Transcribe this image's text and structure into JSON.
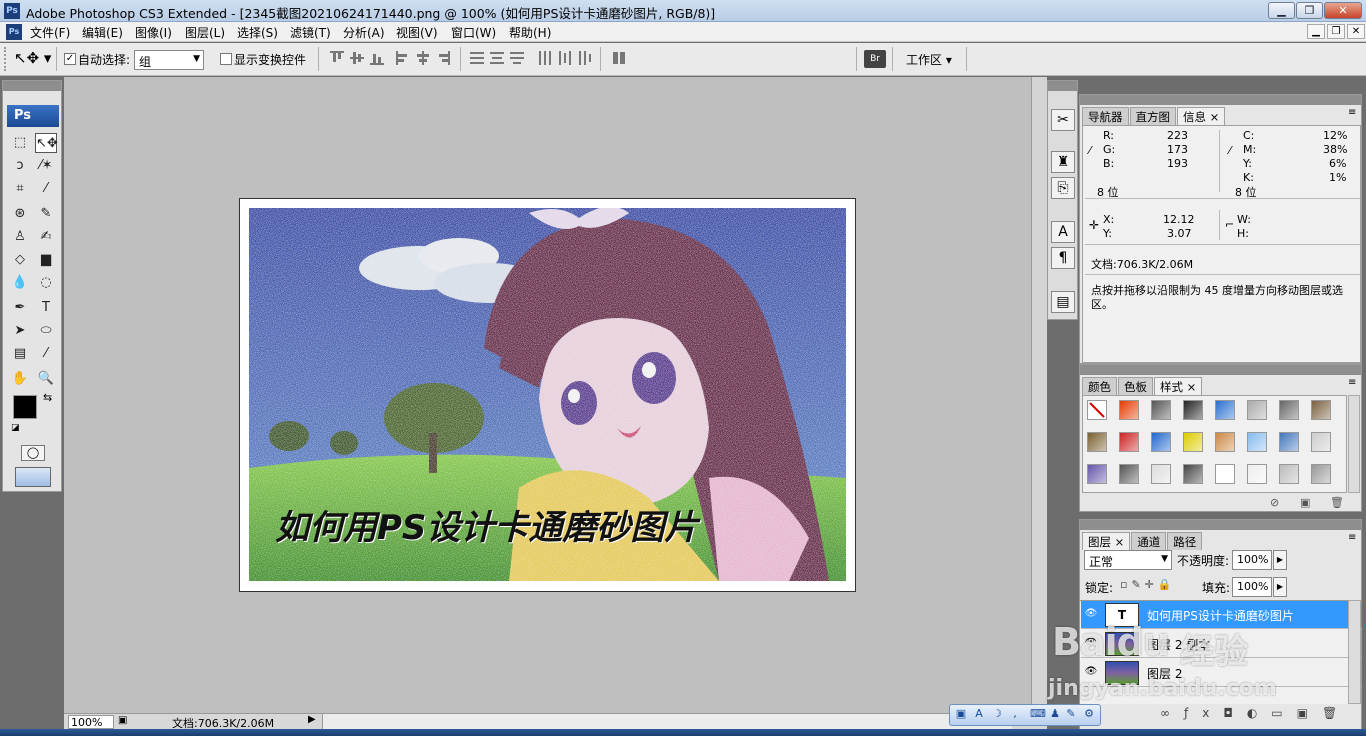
{
  "window": {
    "title": "Adobe Photoshop CS3 Extended - [2345截图20210624171440.png @ 100% (如何用PS设计卡通磨砂图片, RGB/8)]",
    "min": "▁",
    "max": "❐",
    "close": "✕"
  },
  "menu": {
    "items": [
      "文件(F)",
      "编辑(E)",
      "图像(I)",
      "图层(L)",
      "选择(S)",
      "滤镜(T)",
      "分析(A)",
      "视图(V)",
      "窗口(W)",
      "帮助(H)"
    ],
    "doc_min": "▁",
    "doc_max": "❐",
    "doc_close": "✕"
  },
  "options": {
    "auto_select_label": "自动选择:",
    "auto_select_checked": true,
    "auto_select_value": "组",
    "show_transform_label": "显示变换控件",
    "show_transform_checked": false,
    "workspace_label": "工作区 ▾"
  },
  "toolbox": {
    "logo": "Ps",
    "tools": [
      {
        "name": "marquee-tool",
        "glyph": "⬚"
      },
      {
        "name": "move-tool",
        "glyph": "↖✥"
      },
      {
        "name": "lasso-tool",
        "glyph": "ↄ"
      },
      {
        "name": "magic-wand-tool",
        "glyph": "⁄✶"
      },
      {
        "name": "crop-tool",
        "glyph": "⌗"
      },
      {
        "name": "slice-tool",
        "glyph": "⁄"
      },
      {
        "name": "healing-brush-tool",
        "glyph": "⊛"
      },
      {
        "name": "brush-tool",
        "glyph": "✎"
      },
      {
        "name": "clone-stamp-tool",
        "glyph": "♙"
      },
      {
        "name": "history-brush-tool",
        "glyph": "✍"
      },
      {
        "name": "eraser-tool",
        "glyph": "◇"
      },
      {
        "name": "gradient-tool",
        "glyph": "▆"
      },
      {
        "name": "blur-tool",
        "glyph": "💧"
      },
      {
        "name": "dodge-tool",
        "glyph": "◌"
      },
      {
        "name": "pen-tool",
        "glyph": "✒"
      },
      {
        "name": "type-tool",
        "glyph": "T"
      },
      {
        "name": "path-selection-tool",
        "glyph": "➤"
      },
      {
        "name": "ellipse-tool",
        "glyph": "⬭"
      },
      {
        "name": "notes-tool",
        "glyph": "▤"
      },
      {
        "name": "eyedropper-tool",
        "glyph": "⁄"
      },
      {
        "name": "hand-tool",
        "glyph": "✋"
      },
      {
        "name": "zoom-tool",
        "glyph": "🔍"
      }
    ]
  },
  "canvas": {
    "overlay_text": "如何用PS设计卡通磨砂图片"
  },
  "statusbar": {
    "zoom": "100%",
    "doc_info": "文档:706.3K/2.06M"
  },
  "info_panel": {
    "tabs": [
      "导航器",
      "直方图",
      "信息"
    ],
    "active_tab": "信息",
    "rgb": {
      "r_label": "R:",
      "r": "223",
      "g_label": "G:",
      "g": "173",
      "b_label": "B:",
      "b": "193",
      "bits": "8 位"
    },
    "cmyk": {
      "c_label": "C:",
      "c": "12%",
      "m_label": "M:",
      "m": "38%",
      "y_label": "Y:",
      "y": "6%",
      "k_label": "K:",
      "k": "1%",
      "bits": "8 位"
    },
    "pos": {
      "x_label": "X:",
      "x": "12.12",
      "y_label": "Y:",
      "y": "3.07"
    },
    "size": {
      "w_label": "W:",
      "h_label": "H:"
    },
    "doc": "文档:706.3K/2.06M",
    "hint": "点按并拖移以沿限制为 45 度增量方向移动图层或选区。"
  },
  "styles_panel": {
    "tabs": [
      "颜色",
      "色板",
      "样式"
    ],
    "active_tab": "样式",
    "swatches": [
      "#ffffff",
      "#e63b00",
      "#555555",
      "#222222",
      "#2a6fd0",
      "#aaaaaa",
      "#666666",
      "#7a6040",
      "#7a6030",
      "#cc2222",
      "#2266cc",
      "#ddcc00",
      "#cc8844",
      "#88bbee",
      "#4477bb",
      "#cccccc",
      "#6655aa",
      "#555555",
      "#dddddd",
      "#444444",
      "#ffffff",
      "#eeeeee",
      "#bbbbbb",
      "#999999"
    ]
  },
  "layers_panel": {
    "tabs": [
      "图层",
      "通道",
      "路径"
    ],
    "active_tab": "图层",
    "blend_mode": "正常",
    "opacity_label": "不透明度:",
    "opacity": "100%",
    "lock_label": "锁定:",
    "fill_label": "填充:",
    "fill": "100%",
    "layers": [
      {
        "name": "如何用PS设计卡通磨砂图片",
        "type": "T",
        "selected": true
      },
      {
        "name": "图层 2 副本",
        "type": "img",
        "selected": false
      },
      {
        "name": "图层 2",
        "type": "img",
        "selected": false
      }
    ]
  },
  "watermark": {
    "brand": "Baidu",
    "text": "经验",
    "url": "jingyan.baidu.com"
  }
}
